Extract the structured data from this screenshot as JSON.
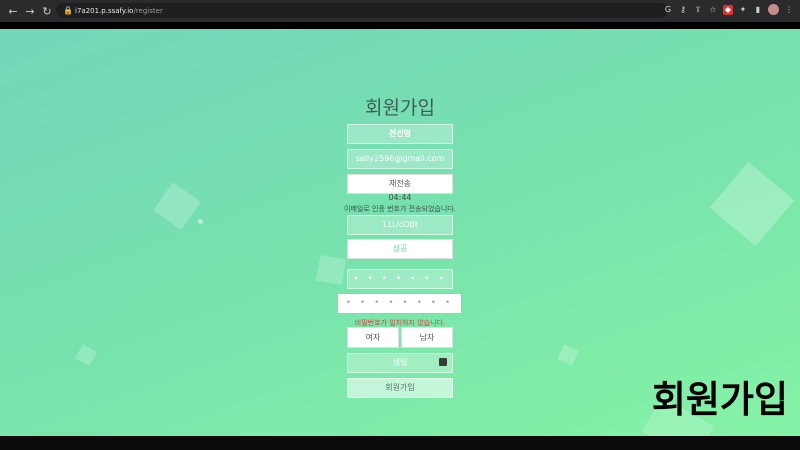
{
  "browser": {
    "url_host": "i7a201.p.ssafy.io",
    "url_path": "/register",
    "icons": [
      "back-icon",
      "forward-icon",
      "reload-icon",
      "home-icon",
      "lock-icon",
      "google-icon",
      "key-icon",
      "share-icon",
      "star-icon",
      "extension-icon",
      "puzzle-icon",
      "sidebar-icon",
      "profile-avatar",
      "menu-icon"
    ]
  },
  "form": {
    "title": "회원가입",
    "name_value": "전선영",
    "email_value": "sally2596@gmail.com",
    "resend_label": "재전송",
    "timer": "04:44",
    "notice": "이메일로 인증 번호가 전송되었습니다.",
    "code_value": "11LlcOBt",
    "confirm_label": "성공",
    "password_mask": "• • • • • • • • •",
    "password_confirm_mask": "• • • • • • • •",
    "password_error": "비밀번호가 일치하지 않습니다.",
    "gender_female": "여자",
    "gender_male": "남자",
    "birthday_placeholder": "생일",
    "submit_label": "회원가입"
  },
  "overlay_caption": "회원가입",
  "colors": {
    "bg_start": "#73d6bb",
    "bg_end": "#85f3a6",
    "error": "#e33b3b"
  }
}
